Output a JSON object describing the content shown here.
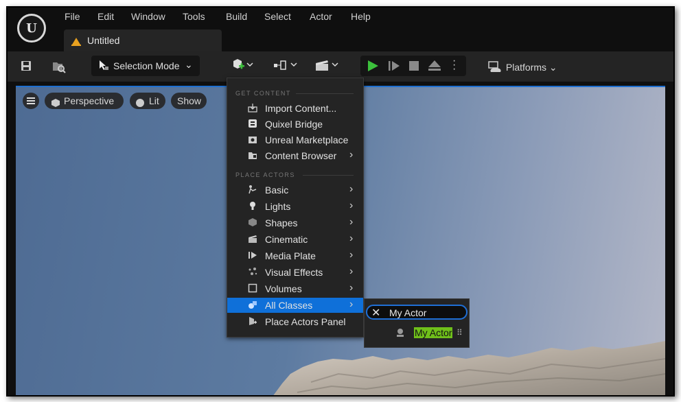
{
  "menubar": {
    "logo": "U",
    "items": [
      "File",
      "Edit",
      "Window",
      "Tools",
      "Build",
      "Select",
      "Actor",
      "Help"
    ]
  },
  "tab": {
    "title": "Untitled"
  },
  "toolbar": {
    "selection_mode": "Selection Mode",
    "platforms": "Platforms"
  },
  "viewport": {
    "perspective": "Perspective",
    "lit": "Lit",
    "show": "Show"
  },
  "dropdown": {
    "get_content_header": "GET CONTENT",
    "get_content": [
      {
        "label": "Import Content...",
        "icon": "import-icon",
        "submenu": false
      },
      {
        "label": "Quixel Bridge",
        "icon": "bridge-icon",
        "submenu": false
      },
      {
        "label": "Unreal Marketplace",
        "icon": "marketplace-icon",
        "submenu": false
      },
      {
        "label": "Content Browser",
        "icon": "content-browser-icon",
        "submenu": true
      }
    ],
    "place_actors_header": "PLACE ACTORS",
    "place_actors": [
      {
        "label": "Basic",
        "icon": "basic-icon",
        "submenu": true
      },
      {
        "label": "Lights",
        "icon": "light-icon",
        "submenu": true
      },
      {
        "label": "Shapes",
        "icon": "shapes-icon",
        "submenu": true
      },
      {
        "label": "Cinematic",
        "icon": "cinematic-icon",
        "submenu": true
      },
      {
        "label": "Media Plate",
        "icon": "media-plate-icon",
        "submenu": true
      },
      {
        "label": "Visual Effects",
        "icon": "visual-effects-icon",
        "submenu": true
      },
      {
        "label": "Volumes",
        "icon": "volumes-icon",
        "submenu": true
      },
      {
        "label": "All Classes",
        "icon": "all-classes-icon",
        "submenu": true,
        "highlighted": true
      },
      {
        "label": "Place Actors Panel",
        "icon": "place-actors-icon",
        "submenu": false
      }
    ]
  },
  "submenu": {
    "search_value": "My Actor",
    "result": "My Actor"
  },
  "colors": {
    "highlight": "#0f70d9",
    "match_highlight": "#6fbf1a",
    "play_green": "#3cc03c"
  }
}
